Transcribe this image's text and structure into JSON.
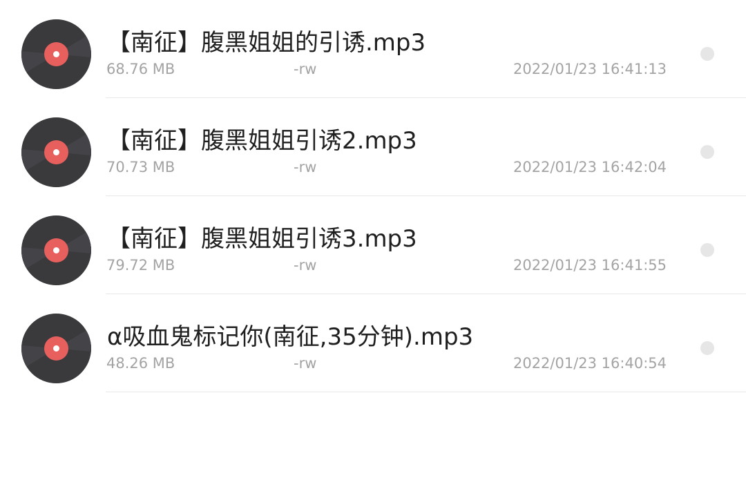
{
  "files": [
    {
      "name": "【南征】腹黑姐姐的引诱.mp3",
      "size": "68.76 MB",
      "permissions": "-rw",
      "modified": "2022/01/23 16:41:13",
      "icon": "music-disc-icon"
    },
    {
      "name": "【南征】腹黑姐姐引诱2.mp3",
      "size": "70.73 MB",
      "permissions": "-rw",
      "modified": "2022/01/23 16:42:04",
      "icon": "music-disc-icon"
    },
    {
      "name": "【南征】腹黑姐姐引诱3.mp3",
      "size": "79.72 MB",
      "permissions": "-rw",
      "modified": "2022/01/23 16:41:55",
      "icon": "music-disc-icon"
    },
    {
      "name": "α吸血鬼标记你(南征,35分钟).mp3",
      "size": "48.26 MB",
      "permissions": "-rw",
      "modified": "2022/01/23 16:40:54",
      "icon": "music-disc-icon"
    }
  ],
  "colors": {
    "disc": "#3a3a3d",
    "disc_label": "#e8605e",
    "text_primary": "#1f1f1f",
    "text_secondary": "#a3a3a3"
  }
}
